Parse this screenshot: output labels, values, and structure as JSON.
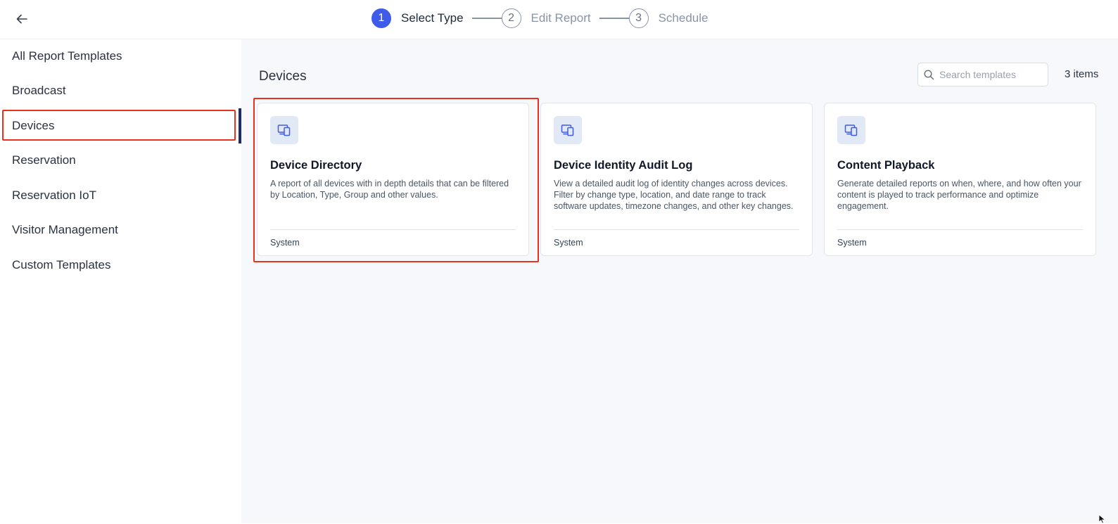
{
  "header": {
    "back_label": "Back",
    "steps": [
      {
        "number": "1",
        "label": "Select Type",
        "active": true
      },
      {
        "number": "2",
        "label": "Edit Report",
        "active": false
      },
      {
        "number": "3",
        "label": "Schedule",
        "active": false
      }
    ]
  },
  "sidebar": {
    "items": [
      {
        "label": "All Report Templates"
      },
      {
        "label": "Broadcast"
      },
      {
        "label": "Devices",
        "selected": true
      },
      {
        "label": "Reservation"
      },
      {
        "label": "Reservation IoT"
      },
      {
        "label": "Visitor Management"
      },
      {
        "label": "Custom Templates"
      }
    ]
  },
  "main": {
    "title": "Devices",
    "search": {
      "placeholder": "Search templates",
      "value": ""
    },
    "item_count": "3 items",
    "cards": [
      {
        "icon": "devices-icon",
        "title": "Device Directory",
        "description": "A report of all devices with in depth details that can be filtered by Location, Type, Group and other values.",
        "footer": "System"
      },
      {
        "icon": "devices-icon",
        "title": "Device Identity Audit Log",
        "description": "View a detailed audit log of identity changes across devices. Filter by change type, location, and date range to track software updates, timezone changes, and other key changes.",
        "footer": "System"
      },
      {
        "icon": "devices-icon",
        "title": "Content Playback",
        "description": "Generate detailed reports on when, where, and how often your content is played to track performance and optimize engagement.",
        "footer": "System"
      }
    ]
  },
  "colors": {
    "accent": "#3f5be9",
    "highlight": "#e8321e",
    "active_indicator": "#1e2a6b"
  }
}
